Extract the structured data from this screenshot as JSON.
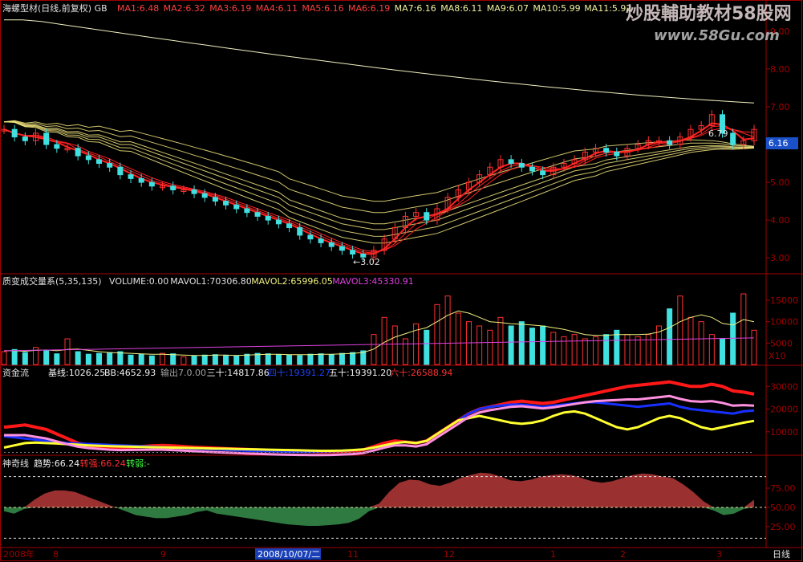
{
  "colors": {
    "background": "#000000",
    "frame": "#a00000",
    "up": "#ff3030",
    "down": "#40e0e0",
    "ma_long": "#f0f0c0",
    "ma_yellow": "#f5e880",
    "ma_red": "#ff2020"
  },
  "watermark": {
    "line1": "炒股輔助教材58股网",
    "line2": "www.58Gu.com"
  },
  "panels": {
    "price": {
      "title": "海螺型材(日线,前复权) GB",
      "ma_labels": [
        {
          "text": "MA1:6.48",
          "color": "#ff4040"
        },
        {
          "text": "MA2:6.32",
          "color": "#ff4040"
        },
        {
          "text": "MA3:6.19",
          "color": "#ff4040"
        },
        {
          "text": "MA4:6.11",
          "color": "#ff4040"
        },
        {
          "text": "MA5:6.16",
          "color": "#ff4040"
        },
        {
          "text": "MA6:6.19",
          "color": "#ff4040"
        },
        {
          "text": "MA7:6.16",
          "color": "#f0f0a0"
        },
        {
          "text": "MA8:6.11",
          "color": "#f0f0a0"
        },
        {
          "text": "MA9:6.07",
          "color": "#f0f0a0"
        },
        {
          "text": "MA10:5.99",
          "color": "#f0f0a0"
        },
        {
          "text": "MA11:5.92",
          "color": "#f0f0a0"
        }
      ],
      "y_ticks": [
        "9.00",
        "8.00",
        "7.00",
        "6.00",
        "5.00",
        "4.00",
        "3.00"
      ],
      "current_price": "6.16",
      "low_label": "3.02",
      "high_label": "6.79"
    },
    "volume": {
      "title": "质变成交量系(5,35,135)",
      "labels": [
        {
          "text": "VOLUME:0.00",
          "color": "#e0e0e0"
        },
        {
          "text": "MAVOL1:70306.80",
          "color": "#e0e0e0"
        },
        {
          "text": "MAVOL2:65996.05",
          "color": "#f0f080"
        },
        {
          "text": "MAVOL3:45330.91",
          "color": "#e040e0"
        }
      ],
      "y_ticks": [
        "15000",
        "10000",
        "5000"
      ],
      "unit": "X10"
    },
    "capital": {
      "title": "资金流",
      "labels": [
        {
          "text": "基线:1026.25",
          "color": "#f0f0f0"
        },
        {
          "text": "BB:4652.93",
          "color": "#f0f0f0"
        },
        {
          "text": "输出7.0.00",
          "color": "#a0a0a0"
        },
        {
          "text": "三十:14817.86",
          "color": "#f0f0f0"
        },
        {
          "text": "四十:19391.27",
          "color": "#2040ff"
        },
        {
          "text": "五十:19391.20",
          "color": "#f0f0f0"
        },
        {
          "text": "六十:26588.94",
          "color": "#ff3030"
        }
      ],
      "y_ticks": [
        "30000",
        "20000",
        "10000"
      ]
    },
    "magic": {
      "title": "神奇线",
      "labels": [
        {
          "text": "趋势:66.24",
          "color": "#f0f0f0"
        },
        {
          "text": "转强:66.24",
          "color": "#ff3030"
        },
        {
          "text": "转弱:-",
          "color": "#40ff40"
        }
      ],
      "y_ticks": [
        "75.00",
        "50.00",
        "25.00"
      ]
    }
  },
  "x_axis": {
    "labels": [
      "2008年",
      "8",
      "9",
      "2008/10/07/二",
      "11",
      "12",
      "1",
      "2",
      "3"
    ],
    "period": "日线"
  },
  "chart_data": [
    {
      "type": "line",
      "title": "海螺型材(日线,前复权) GB",
      "description": "Daily candlestick price with moving averages",
      "ylim": [
        2.6,
        9.4
      ],
      "series": [
        {
          "name": "close",
          "values": [
            6.4,
            6.2,
            6.1,
            6.3,
            6.0,
            5.9,
            5.9,
            5.7,
            5.6,
            5.5,
            5.4,
            5.2,
            5.1,
            5.0,
            4.9,
            4.9,
            4.8,
            4.8,
            4.7,
            4.6,
            4.5,
            4.4,
            4.3,
            4.2,
            4.1,
            4.0,
            3.9,
            3.8,
            3.6,
            3.5,
            3.4,
            3.3,
            3.2,
            3.1,
            3.02,
            3.2,
            3.5,
            3.8,
            4.1,
            4.2,
            4.0,
            4.3,
            4.6,
            4.8,
            5.0,
            5.2,
            5.4,
            5.6,
            5.5,
            5.4,
            5.3,
            5.2,
            5.4,
            5.5,
            5.6,
            5.8,
            5.9,
            5.8,
            5.7,
            5.9,
            6.0,
            6.1,
            6.1,
            6.0,
            6.2,
            6.4,
            6.5,
            6.79,
            6.3,
            6.0,
            6.1,
            6.4
          ]
        },
        {
          "name": "MA11",
          "values": [
            6.6,
            6.6,
            6.5,
            6.5,
            6.4,
            6.4,
            6.3,
            6.3,
            6.2,
            6.2,
            6.1,
            6.0,
            6.0,
            5.9,
            5.8,
            5.7,
            5.6,
            5.5,
            5.4,
            5.3,
            5.2,
            5.1,
            5.0,
            4.9,
            4.8,
            4.7,
            4.6,
            4.4,
            4.3,
            4.2,
            4.1,
            4.0,
            3.9,
            3.85,
            3.8,
            3.75,
            3.75,
            3.8,
            3.85,
            3.9,
            3.95,
            4.0,
            4.1,
            4.2,
            4.3,
            4.4,
            4.5,
            4.6,
            4.7,
            4.8,
            4.9,
            5.0,
            5.1,
            5.2,
            5.3,
            5.35,
            5.4,
            5.5,
            5.55,
            5.6,
            5.65,
            5.7,
            5.75,
            5.8,
            5.85,
            5.9,
            5.92,
            5.94,
            5.94,
            5.92,
            5.92,
            5.92
          ]
        }
      ]
    },
    {
      "type": "bar",
      "title": "质变成交量系(5,35,135)",
      "ylim": [
        0,
        18000
      ],
      "series": [
        {
          "name": "VOLUME",
          "values": [
            3000,
            3500,
            2800,
            4000,
            3200,
            2500,
            6000,
            3000,
            2400,
            2600,
            2800,
            3000,
            2200,
            2400,
            2000,
            2600,
            2500,
            1800,
            2000,
            2200,
            2300,
            2100,
            2000,
            2400,
            2600,
            2500,
            2300,
            2200,
            2100,
            2400,
            2500,
            2300,
            2600,
            2800,
            3200,
            7000,
            11000,
            9000,
            6000,
            9500,
            8000,
            14000,
            16000,
            12000,
            10000,
            9000,
            8000,
            11000,
            9000,
            10000,
            8500,
            9000,
            7500,
            6500,
            7000,
            6000,
            6500,
            7000,
            8000,
            7000,
            6500,
            7000,
            9000,
            13000,
            16000,
            11000,
            10000,
            7000,
            6000,
            12000,
            16500,
            8000
          ]
        },
        {
          "name": "MAVOL1",
          "values": [
            3200,
            3200,
            3100,
            3300,
            3400,
            3200,
            3500,
            3600,
            3300,
            3000,
            2800,
            2700,
            2600,
            2500,
            2400,
            2400,
            2300,
            2200,
            2100,
            2100,
            2200,
            2200,
            2100,
            2200,
            2300,
            2400,
            2400,
            2300,
            2300,
            2300,
            2400,
            2400,
            2500,
            2600,
            2800,
            3600,
            5200,
            6400,
            7200,
            8000,
            8600,
            10000,
            11500,
            12500,
            12000,
            11000,
            10000,
            9800,
            9500,
            9400,
            9200,
            9000,
            8600,
            8200,
            7600,
            7000,
            6800,
            6800,
            7000,
            7000,
            7000,
            7100,
            7600,
            8600,
            10000,
            11000,
            11600,
            11000,
            9600,
            9200,
            10500,
            10000
          ]
        }
      ]
    },
    {
      "type": "line",
      "title": "资金流",
      "ylim": [
        0,
        34000
      ],
      "series": [
        {
          "name": "六十",
          "values": [
            12000,
            12500,
            13000,
            12000,
            11000,
            9000,
            7000,
            5000,
            4000,
            3500,
            3000,
            2800,
            3200,
            3500,
            3800,
            4000,
            3800,
            3500,
            3200,
            3000,
            2800,
            2600,
            2400,
            2200,
            2000,
            1800,
            1600,
            1500,
            1400,
            1300,
            1200,
            1200,
            1300,
            1500,
            2000,
            3500,
            5000,
            6000,
            5500,
            5000,
            6000,
            9000,
            12000,
            15000,
            18000,
            20000,
            21000,
            22000,
            23000,
            23500,
            23000,
            22500,
            23000,
            24000,
            25000,
            26000,
            27000,
            28000,
            29000,
            30000,
            30500,
            31000,
            31500,
            32000,
            31000,
            30000,
            30000,
            31000,
            30000,
            28000,
            27500,
            26588
          ]
        },
        {
          "name": "四十",
          "values": [
            8000,
            7500,
            7000,
            6500,
            6000,
            5500,
            5000,
            4800,
            4600,
            4400,
            4200,
            4000,
            3800,
            3600,
            3400,
            3200,
            3000,
            2800,
            2600,
            2400,
            2200,
            2000,
            1800,
            1600,
            1500,
            1400,
            1300,
            1200,
            1200,
            1200,
            1300,
            1400,
            1600,
            1800,
            2200,
            3000,
            4000,
            5000,
            5500,
            5000,
            6000,
            9000,
            12000,
            15000,
            18000,
            20000,
            21000,
            21500,
            22000,
            22000,
            21500,
            21000,
            21500,
            22000,
            22500,
            23000,
            23000,
            22500,
            22000,
            21500,
            21000,
            21500,
            22000,
            22500,
            21000,
            20000,
            19500,
            19000,
            18500,
            18000,
            19000,
            19391
          ]
        },
        {
          "name": "三十",
          "values": [
            3000,
            4000,
            5000,
            5200,
            5000,
            4800,
            4500,
            4300,
            4000,
            3800,
            3600,
            3500,
            3400,
            3300,
            3200,
            3100,
            3000,
            2900,
            2800,
            2700,
            2600,
            2500,
            2400,
            2300,
            2200,
            2100,
            2000,
            1900,
            1800,
            1700,
            1600,
            1600,
            1700,
            1900,
            2200,
            3000,
            4000,
            5000,
            5500,
            5000,
            6000,
            9000,
            12000,
            15000,
            16000,
            17000,
            16000,
            15000,
            14000,
            13500,
            14000,
            15000,
            17000,
            18500,
            19000,
            18000,
            16000,
            14000,
            12000,
            11000,
            12000,
            14000,
            16000,
            17000,
            16000,
            14000,
            12000,
            11000,
            12000,
            13000,
            14000,
            14817
          ]
        }
      ]
    },
    {
      "type": "area",
      "title": "神奇线",
      "ylim": [
        0,
        100
      ],
      "series": [
        {
          "name": "趋势",
          "values": [
            45,
            42,
            48,
            60,
            68,
            72,
            72,
            70,
            65,
            60,
            55,
            50,
            45,
            40,
            38,
            36,
            36,
            38,
            40,
            44,
            46,
            42,
            40,
            38,
            36,
            34,
            32,
            30,
            28,
            27,
            26,
            26,
            27,
            28,
            30,
            35,
            45,
            55,
            70,
            82,
            86,
            85,
            80,
            78,
            82,
            88,
            92,
            95,
            94,
            90,
            85,
            84,
            86,
            90,
            92,
            93,
            92,
            88,
            84,
            82,
            84,
            88,
            92,
            94,
            93,
            90,
            88,
            80,
            70,
            58,
            46,
            40,
            42,
            48,
            60
          ]
        }
      ]
    }
  ]
}
